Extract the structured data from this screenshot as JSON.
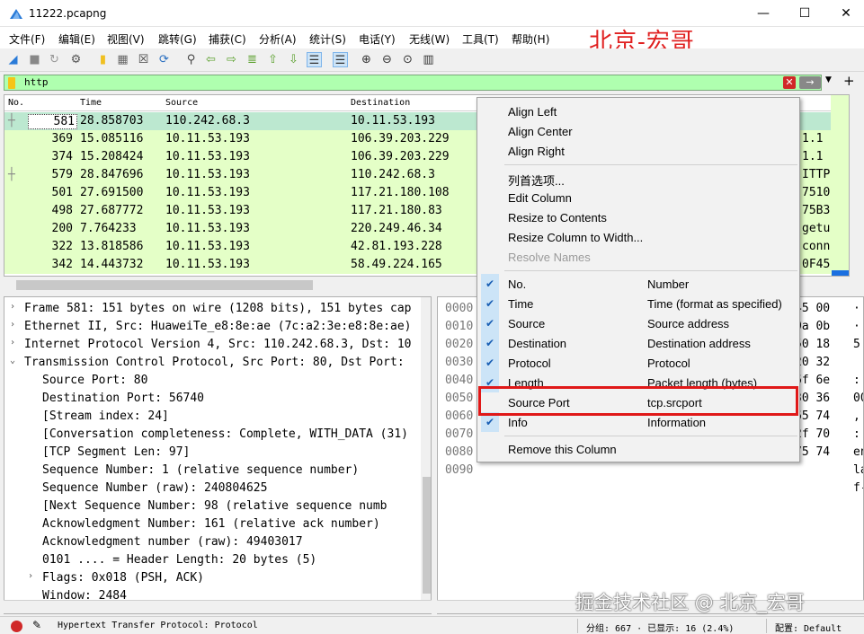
{
  "window": {
    "title": "11222.pcapng",
    "min": "—",
    "max": "☐",
    "close": "✕"
  },
  "menu": [
    "文件(F)",
    "编辑(E)",
    "视图(V)",
    "跳转(G)",
    "捕获(C)",
    "分析(A)",
    "统计(S)",
    "电话(Y)",
    "无线(W)",
    "工具(T)",
    "帮助(H)"
  ],
  "watermark_top": "北京-宏哥",
  "toolbar_icons": [
    "shark-fin-icon",
    "stop-icon",
    "restart-icon",
    "options-icon",
    "open-file-icon",
    "save-icon",
    "close-file-icon",
    "reload-icon",
    "find-icon",
    "back-icon",
    "forward-icon",
    "goto-icon",
    "first-icon",
    "last-icon",
    "autoscroll-icon",
    "colorize-icon",
    "zoom-in-icon",
    "zoom-out-icon",
    "zoom-normal-icon",
    "resize-columns-icon"
  ],
  "filter": {
    "text": "http",
    "clear": "✕",
    "apply": "→",
    "dropdown": "▼",
    "add": "+"
  },
  "packet_list": {
    "headers": {
      "no": "No.",
      "time": "Time",
      "source": "Source",
      "destination": "Destination"
    },
    "rows": [
      {
        "no": "581",
        "time": "28.858703",
        "source": "110.242.68.3",
        "destination": "10.11.53.193",
        "tail": "",
        "selected": true
      },
      {
        "no": "369",
        "time": "15.085116",
        "source": "10.11.53.193",
        "destination": "106.39.203.229",
        "tail": "1.1"
      },
      {
        "no": "374",
        "time": "15.208424",
        "source": "10.11.53.193",
        "destination": "106.39.203.229",
        "tail": "1.1"
      },
      {
        "no": "579",
        "time": "28.847696",
        "source": "10.11.53.193",
        "destination": "110.242.68.3",
        "tail": "ITTP"
      },
      {
        "no": "501",
        "time": "27.691500",
        "source": "10.11.53.193",
        "destination": "117.21.180.108",
        "tail": "7510"
      },
      {
        "no": "498",
        "time": "27.687772",
        "source": "10.11.53.193",
        "destination": "117.21.180.83",
        "tail": "75B3"
      },
      {
        "no": "200",
        "time": "7.764233",
        "source": "10.11.53.193",
        "destination": "220.249.46.34",
        "tail": "getu"
      },
      {
        "no": "322",
        "time": "13.818586",
        "source": "10.11.53.193",
        "destination": "42.81.193.228",
        "tail": "conn"
      },
      {
        "no": "342",
        "time": "14.443732",
        "source": "10.11.53.193",
        "destination": "58.49.224.165",
        "tail": "0F45"
      }
    ]
  },
  "details": [
    {
      "arrow": "›",
      "indent": 0,
      "text": "Frame 581: 151 bytes on wire (1208 bits), 151 bytes cap"
    },
    {
      "arrow": "›",
      "indent": 0,
      "text": "Ethernet II, Src: HuaweiTe_e8:8e:ae (7c:a2:3e:e8:8e:ae)"
    },
    {
      "arrow": "›",
      "indent": 0,
      "text": "Internet Protocol Version 4, Src: 110.242.68.3, Dst: 10"
    },
    {
      "arrow": "⌄",
      "indent": 0,
      "text": "Transmission Control Protocol, Src Port: 80, Dst Port:"
    },
    {
      "arrow": "",
      "indent": 1,
      "text": "Source Port: 80"
    },
    {
      "arrow": "",
      "indent": 1,
      "text": "Destination Port: 56740"
    },
    {
      "arrow": "",
      "indent": 1,
      "text": "[Stream index: 24]"
    },
    {
      "arrow": "",
      "indent": 1,
      "text": "[Conversation completeness: Complete, WITH_DATA (31)"
    },
    {
      "arrow": "",
      "indent": 1,
      "text": "[TCP Segment Len: 97]"
    },
    {
      "arrow": "",
      "indent": 1,
      "text": "Sequence Number: 1    (relative sequence number)"
    },
    {
      "arrow": "",
      "indent": 1,
      "text": "Sequence Number (raw): 240804625"
    },
    {
      "arrow": "",
      "indent": 1,
      "text": "[Next Sequence Number: 98    (relative sequence numb"
    },
    {
      "arrow": "",
      "indent": 1,
      "text": "Acknowledgment Number: 161    (relative ack number)"
    },
    {
      "arrow": "",
      "indent": 1,
      "text": "Acknowledgment number (raw): 49403017"
    },
    {
      "arrow": "",
      "indent": 1,
      "text": "0101 .... = Header Length: 20 bytes (5)"
    },
    {
      "arrow": "›",
      "indent": 1,
      "text": "Flags: 0x018 (PSH, ACK)"
    },
    {
      "arrow": "",
      "indent": 1,
      "text": "Window: 2484"
    }
  ],
  "bytes": {
    "offsets": [
      "0000",
      "0010",
      "0020",
      "0030",
      "0040",
      "0050",
      "0060",
      "0070",
      "0080",
      "0090"
    ],
    "right_hex": [
      "45 00",
      "0a 0b",
      "50 18",
      "20 32",
      "6f 6e",
      "30 36",
      "65 74",
      "2f 70",
      "75 74",
      ""
    ],
    "right_ascii": [
      "·",
      "·",
      "5",
      "",
      ":",
      "00",
      ",",
      ":",
      "en",
      "la",
      "f-"
    ]
  },
  "context_menu": {
    "top_items": [
      "Align Left",
      "Align Center",
      "Align Right"
    ],
    "mid_items": [
      {
        "label": "列首选项...",
        "disabled": false
      },
      {
        "label": "Edit Column",
        "disabled": false
      },
      {
        "label": "Resize to Contents",
        "disabled": false
      },
      {
        "label": "Resize Column to Width...",
        "disabled": false
      },
      {
        "label": "Resolve Names",
        "disabled": true
      }
    ],
    "columns": [
      {
        "label": "No.",
        "desc": "Number",
        "checked": true
      },
      {
        "label": "Time",
        "desc": "Time (format as specified)",
        "checked": true
      },
      {
        "label": "Source",
        "desc": "Source address",
        "checked": true
      },
      {
        "label": "Destination",
        "desc": "Destination address",
        "checked": true
      },
      {
        "label": "Protocol",
        "desc": "Protocol",
        "checked": true
      },
      {
        "label": "Length",
        "desc": "Packet length (bytes)",
        "checked": true
      },
      {
        "label": "Source Port",
        "desc": "tcp.srcport",
        "checked": false
      },
      {
        "label": "Info",
        "desc": "Information",
        "checked": true
      }
    ],
    "remove": "Remove this Column"
  },
  "status": {
    "field": "Hypertext Transfer Protocol: Protocol",
    "counts": "分组: 667 · 已显示: 16 (2.4%)",
    "profile": "配置: Default"
  },
  "watermark_bottom": "掘金技术社区 @ 北京_宏哥"
}
